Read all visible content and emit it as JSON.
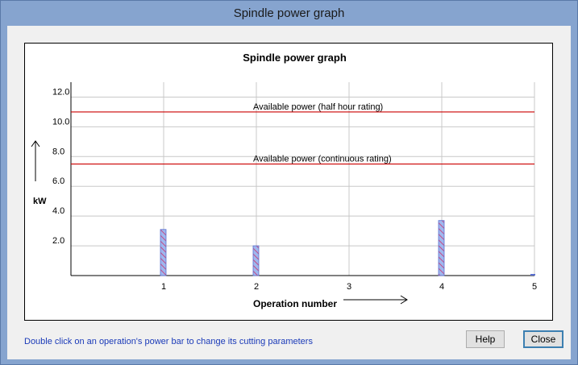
{
  "window": {
    "title": "Spindle power graph"
  },
  "chart_data": {
    "type": "bar",
    "title": "Spindle power graph",
    "ylabel": "kW",
    "xlabel": "Operation number",
    "ylim": [
      0,
      13
    ],
    "xlim": [
      0,
      5
    ],
    "yticks": [
      "2.0",
      "4.0",
      "6.0",
      "8.0",
      "10.0",
      "12.0"
    ],
    "xticks": [
      "1",
      "2",
      "3",
      "4",
      "5"
    ],
    "x": [
      1,
      2,
      3,
      4,
      5
    ],
    "values": [
      3.1,
      2.0,
      0,
      3.7,
      0
    ],
    "bar_color": "#9fb7ee",
    "bar_hatch_color": "#d0306a",
    "grid": true,
    "lines": [
      {
        "label": "Available power (half hour rating)",
        "y": 11.0,
        "color": "#cc0000"
      },
      {
        "label": "Available power (continuous rating)",
        "y": 7.5,
        "color": "#cc0000"
      }
    ]
  },
  "footer": {
    "hint": "Double click on an operation's power bar to change its cutting parameters",
    "help_label": "Help",
    "close_label": "Close"
  }
}
